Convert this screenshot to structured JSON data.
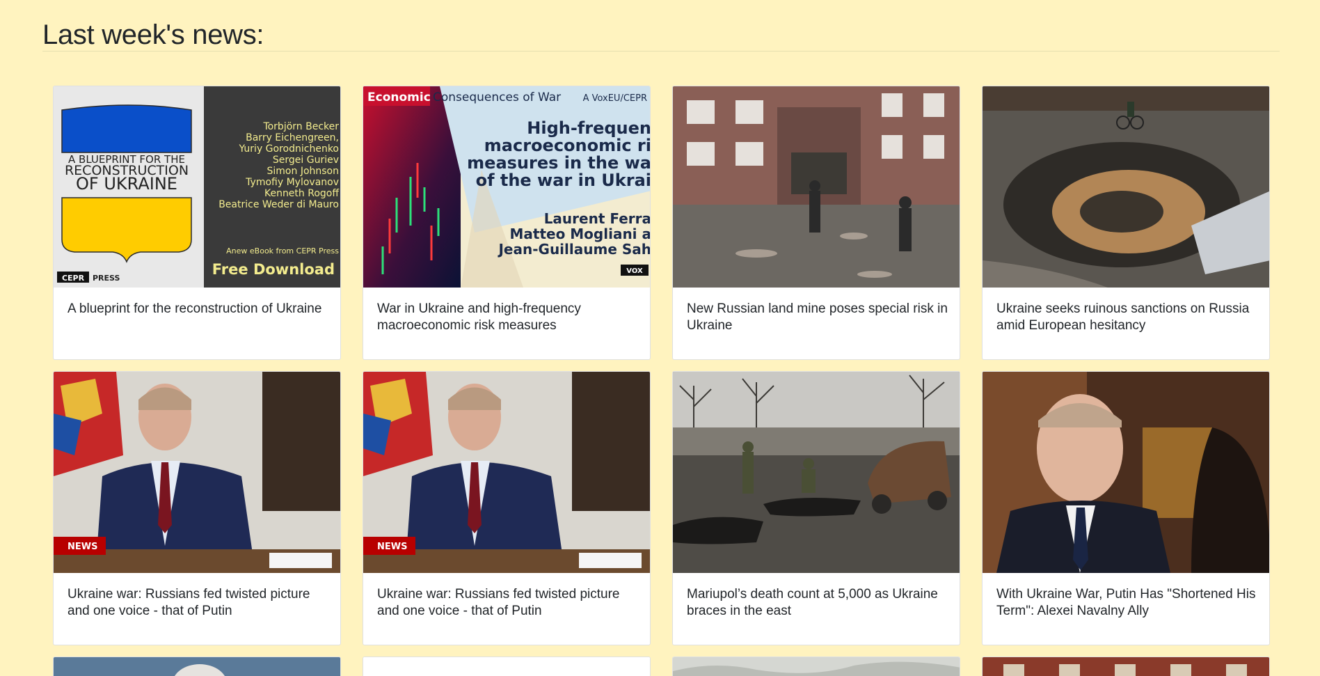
{
  "page": {
    "title": "Last week's news:"
  },
  "cards": [
    {
      "caption": "A blueprint for the reconstruction of Ukraine",
      "image": {
        "shield_left_top": "A BLUEPRINT FOR THE",
        "shield_left_mid": "RECONSTRUCTION",
        "shield_left_bot": "OF UKRAINE",
        "authors": [
          "Torbjörn Becker",
          "Barry Eichengreen,",
          "Yuriy Gorodnichenko",
          "Sergei Guriev",
          "Simon Johnson",
          "Tymofiy Mylovanov",
          "Kenneth Rogoff",
          "Beatrice Weder di Mauro"
        ],
        "ebook_note": "Anew eBook from CEPR Press",
        "download": "Free Download",
        "cepr": "CEPR",
        "press": "PRESS"
      }
    },
    {
      "caption": "War in Ukraine and high-frequency macroeconomic risk measures",
      "image": {
        "banner_a": "Economic",
        "banner_b": "Consequences of War",
        "voxeu": "A VoxEU/CEPR",
        "headline": [
          "High-frequen",
          "macroeconomic ri",
          "measures in the wa",
          "of the war in Ukrai"
        ],
        "authors": [
          "Laurent Ferra",
          "Matteo Mogliani a",
          "Jean-Guillaume Sah"
        ],
        "vox": "VOX"
      }
    },
    {
      "caption": "New Russian land mine poses special risk in Ukraine"
    },
    {
      "caption": "Ukraine seeks ruinous sanctions on Russia amid European hesitancy"
    },
    {
      "caption": "Ukraine war: Russians fed twisted picture and one voice - that of Putin",
      "image": {
        "badge": "NEWS"
      }
    },
    {
      "caption": "Ukraine war: Russians fed twisted picture and one voice - that of Putin",
      "image": {
        "badge": "NEWS"
      }
    },
    {
      "caption": "Mariupol’s death count at 5,000 as Ukraine braces in the east"
    },
    {
      "caption": "With Ukraine War, Putin Has \"Shortened His Term\": Alexei Navalny Ally"
    }
  ],
  "colors": {
    "background": "#fff3bf",
    "card": "#ffffff",
    "ua_blue": "#0a4fc9",
    "ua_yellow": "#ffcc00",
    "bbc_red": "#b80000"
  }
}
